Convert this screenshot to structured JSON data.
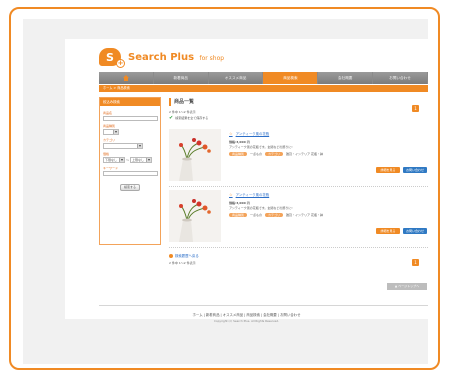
{
  "brand": {
    "logo_letter": "S",
    "name": "Search Plus",
    "suffix": "for shop"
  },
  "nav": [
    "",
    "新着商品",
    "オススメ商品",
    "商品検索",
    "会社概要",
    "お問い合わせ"
  ],
  "breadcrumb": "ホーム > 商品検索",
  "sidebar": {
    "heading": "絞込み検索",
    "fields": {
      "name_label": "商品名",
      "type_label": "商品種別",
      "category_label": "カテゴリ",
      "price_label": "価格",
      "price_from": "下限なし",
      "price_sep": "〜",
      "price_to": "上限なし",
      "keyword_label": "キーワード"
    },
    "search_button": "検索する"
  },
  "main": {
    "title": "商品一覧",
    "count": "2 件中 1〜2 件表示",
    "checkbox_label": "検索結果を全て保存する",
    "items": [
      {
        "name": "アンティーク風の花瓶",
        "price": "価格:3,000 円",
        "description": "アンティーク風の花瓶です。玄関などの飾りに!",
        "tag1": "商品種別",
        "tag1_value": "一点もの",
        "tag2": "カテゴリ",
        "tag2_value": "雑貨・インテリア 花瓶・鉢",
        "btn_detail": "詳細を見る",
        "btn_contact": "お問い合わせ"
      },
      {
        "name": "アンティーク風の花瓶",
        "price": "価格:3,000 円",
        "description": "アンティーク風の花瓶です。玄関などの飾りに!",
        "tag1": "商品種別",
        "tag1_value": "一点もの",
        "tag2": "カテゴリ",
        "tag2_value": "雑貨・インテリア 花瓶・鉢",
        "btn_detail": "詳細を見る",
        "btn_contact": "お問い合わせ"
      }
    ],
    "history_link": "検索履歴へ戻る",
    "count_bottom": "2 件中 1〜2 件表示",
    "pager_label": "1",
    "pagetop": "▲ ページトップへ"
  },
  "footer": {
    "links": "ホーム | 新着商品 | オススメ商品 | 商品検索 | 会社概要 | お問い合わせ",
    "copyright": "Copyright (c) Search Plus. All Rights Reserved."
  },
  "colors": {
    "accent": "#f08a24",
    "link": "#2b6ec8",
    "button_blue": "#2f79c3"
  }
}
